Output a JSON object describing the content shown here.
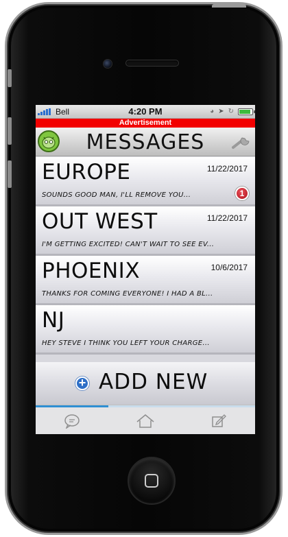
{
  "status": {
    "carrier": "Bell",
    "time": "4:20 PM"
  },
  "ad_label": "Advertisement",
  "header": {
    "title": "MESSAGES"
  },
  "conversations": [
    {
      "title": "EUROPE",
      "date": "11/22/2017",
      "preview": "Sounds good man, I'll remove you...",
      "unread": "1"
    },
    {
      "title": "OUT WEST",
      "date": "11/22/2017",
      "preview": "I'm getting excited! Can't wait to see ev..."
    },
    {
      "title": "PHOENIX",
      "date": "10/6/2017",
      "preview": "Thanks for coming everyone! I had a bl..."
    },
    {
      "title": "NJ",
      "date": "",
      "preview": "Hey Steve I think you left your charge..."
    }
  ],
  "add_new": {
    "label": "ADD NEW"
  },
  "tabs": [
    {
      "name": "messages",
      "icon": "chat-bubble-icon"
    },
    {
      "name": "home",
      "icon": "home-icon"
    },
    {
      "name": "compose",
      "icon": "compose-icon"
    }
  ],
  "colors": {
    "ad_bar": "#f20000",
    "accent": "#2f8fd3",
    "badge": "#d0202a",
    "avatar": "#7fc63f"
  }
}
